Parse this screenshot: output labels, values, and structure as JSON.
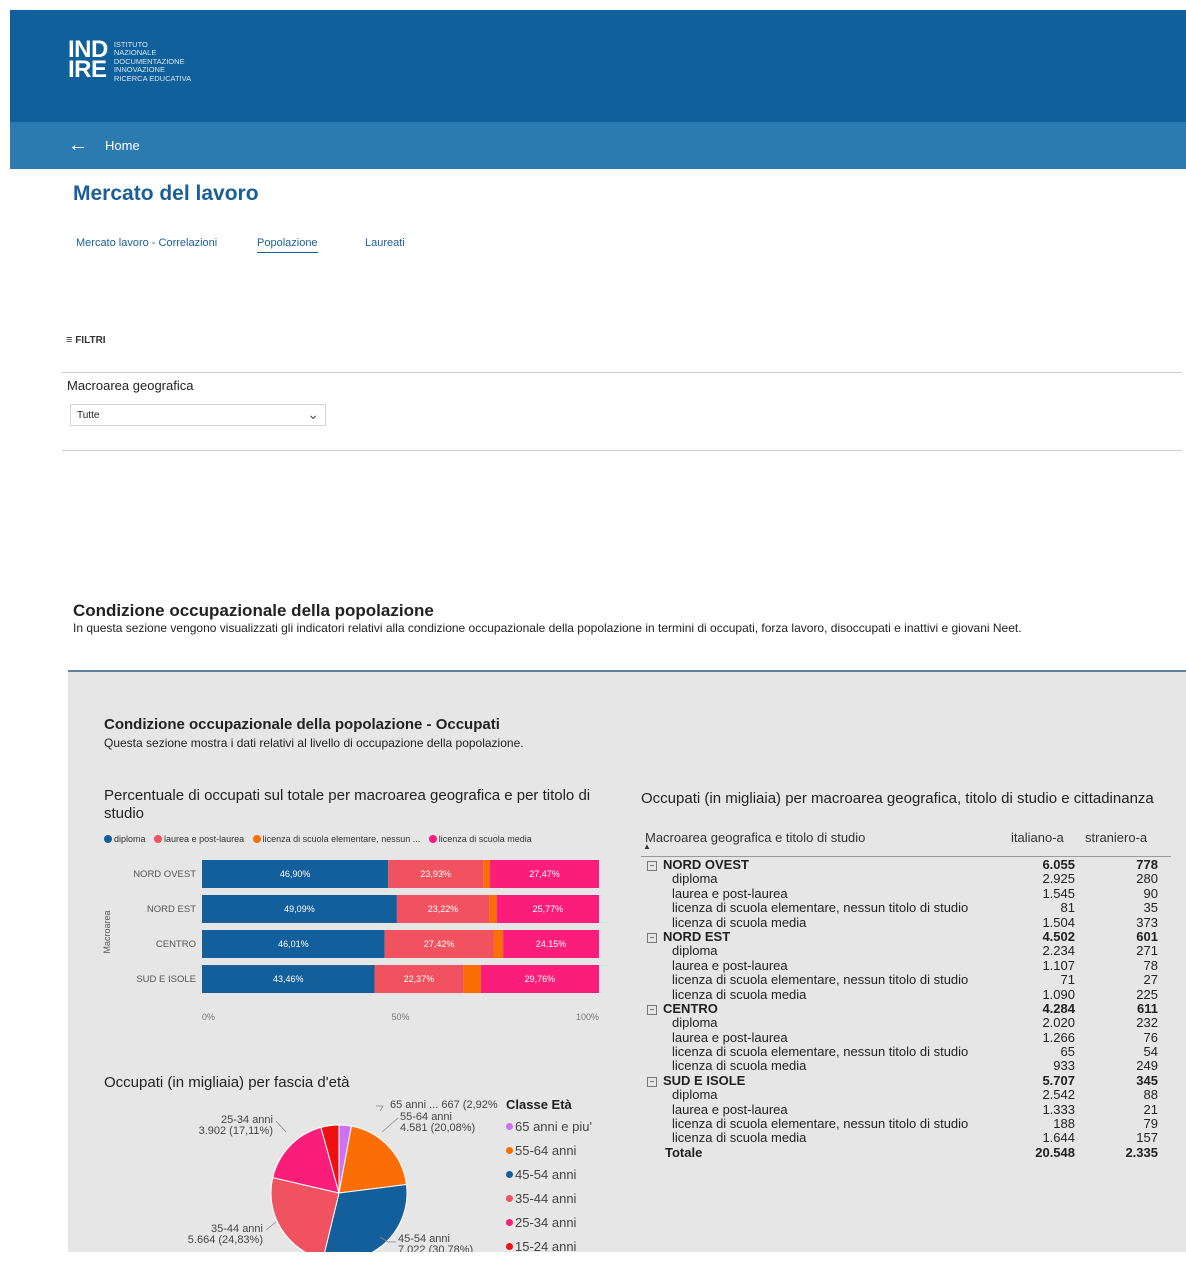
{
  "header": {
    "logo_mark_line1": "IND",
    "logo_mark_line2": "IRE",
    "logo_sub": [
      "ISTITUTO",
      "NAZIONALE",
      "DOCUMENTAZIONE",
      "INNOVAZIONE",
      "RICERCA EDUCATIVA"
    ],
    "back_icon": "arrow-left-icon",
    "home_label": "Home"
  },
  "page_title": "Mercato del lavoro",
  "tabs": [
    {
      "label": "Mercato lavoro - Correlazioni",
      "active": false
    },
    {
      "label": "Popolazione",
      "active": true
    },
    {
      "label": "Laureati",
      "active": false
    }
  ],
  "filters": {
    "label": "FILTRI",
    "icon": "filter-icon",
    "macroarea_label": "Macroarea geografica",
    "macroarea_value": "Tutte"
  },
  "section": {
    "title": "Condizione occupazionale della popolazione",
    "description": "In questa sezione vengono visualizzati gli indicatori relativi alla condizione occupazionale della popolazione in termini di occupati, forza lavoro, disoccupati e inattivi e giovani Neet."
  },
  "panel": {
    "title": "Condizione occupazionale della popolazione - Occupati",
    "description": "Questa sezione mostra i dati relativi al livello di occupazione della popolazione."
  },
  "colors": {
    "diploma": "#135f9c",
    "laurea": "#f0525f",
    "licenza_elementare": "#fb6e05",
    "licenza_media": "#fb1d7a",
    "eta_65": "#cc73f2",
    "eta_15_24": "#ee1111"
  },
  "chart_data": [
    {
      "type": "bar",
      "orientation": "horizontal-stacked-100",
      "title": "Percentuale di occupati sul totale per macroarea geografica e per titolo di studio",
      "ylabel": "Macroarea",
      "categories": [
        "NORD OVEST",
        "NORD EST",
        "CENTRO",
        "SUD E ISOLE"
      ],
      "series": [
        {
          "name": "diploma",
          "values": [
            46.9,
            49.09,
            46.01,
            43.46
          ],
          "labels": [
            "46,90%",
            "49,09%",
            "46,01%",
            "43,46%"
          ]
        },
        {
          "name": "laurea e post-laurea",
          "values": [
            23.93,
            23.22,
            27.42,
            22.37
          ],
          "labels": [
            "23,93%",
            "23,22%",
            "27,42%",
            "22,37%"
          ]
        },
        {
          "name": "licenza di scuola elementare, nessun ...",
          "values": [
            1.7,
            1.92,
            2.42,
            4.41
          ],
          "labels": [
            "",
            "",
            "",
            ""
          ]
        },
        {
          "name": "licenza di scuola media",
          "values": [
            27.47,
            25.77,
            24.15,
            29.76
          ],
          "labels": [
            "27,47%",
            "25,77%",
            "24,15%",
            "29,76%"
          ]
        }
      ],
      "xticks": [
        "0%",
        "50%",
        "100%"
      ],
      "xlim": [
        0,
        100
      ]
    },
    {
      "type": "pie",
      "title": "Occupati (in migliaia) per fascia d'età",
      "legend_title": "Classe Età",
      "slices": [
        {
          "name": "65 anni e piu'",
          "value": 667,
          "label": "65 anni ... 667 (2,92%)"
        },
        {
          "name": "55-64 anni",
          "value": 4581,
          "label": "55-64 anni\n4.581 (20,08%)"
        },
        {
          "name": "45-54 anni",
          "value": 7022,
          "label": "45-54 anni\n7.022 (30,78%)"
        },
        {
          "name": "35-44 anni",
          "value": 5664,
          "label": "35-44 anni\n5.664 (24,83%)"
        },
        {
          "name": "25-34 anni",
          "value": 3902,
          "label": "25-34 anni\n3.902 (17,11%)"
        },
        {
          "name": "15-24 anni",
          "value": 975,
          "label": ""
        }
      ],
      "legend": [
        "65 anni e piu'",
        "55-64 anni",
        "45-54 anni",
        "35-44 anni",
        "25-34 anni",
        "15-24 anni"
      ]
    }
  ],
  "table": {
    "title": "Occupati (in migliaia) per macroarea geografica, titolo di studio e cittadinanza",
    "headers": [
      "Macroarea geografica e titolo di studio",
      "italiano-a",
      "straniero-a"
    ],
    "rows": [
      {
        "type": "grp",
        "label": "NORD OVEST",
        "v1": "6.055",
        "v2": "778"
      },
      {
        "type": "sub",
        "label": "diploma",
        "v1": "2.925",
        "v2": "280"
      },
      {
        "type": "sub",
        "label": "laurea e post-laurea",
        "v1": "1.545",
        "v2": "90"
      },
      {
        "type": "sub",
        "label": "licenza di scuola elementare, nessun titolo di studio",
        "v1": "81",
        "v2": "35"
      },
      {
        "type": "sub",
        "label": "licenza di scuola media",
        "v1": "1.504",
        "v2": "373"
      },
      {
        "type": "grp",
        "label": "NORD EST",
        "v1": "4.502",
        "v2": "601"
      },
      {
        "type": "sub",
        "label": "diploma",
        "v1": "2.234",
        "v2": "271"
      },
      {
        "type": "sub",
        "label": "laurea e post-laurea",
        "v1": "1.107",
        "v2": "78"
      },
      {
        "type": "sub",
        "label": "licenza di scuola elementare, nessun titolo di studio",
        "v1": "71",
        "v2": "27"
      },
      {
        "type": "sub",
        "label": "licenza di scuola media",
        "v1": "1.090",
        "v2": "225"
      },
      {
        "type": "grp",
        "label": "CENTRO",
        "v1": "4.284",
        "v2": "611"
      },
      {
        "type": "sub",
        "label": "diploma",
        "v1": "2.020",
        "v2": "232"
      },
      {
        "type": "sub",
        "label": "laurea e post-laurea",
        "v1": "1.266",
        "v2": "76"
      },
      {
        "type": "sub",
        "label": "licenza di scuola elementare, nessun titolo di studio",
        "v1": "65",
        "v2": "54"
      },
      {
        "type": "sub",
        "label": "licenza di scuola media",
        "v1": "933",
        "v2": "249"
      },
      {
        "type": "grp",
        "label": "SUD E ISOLE",
        "v1": "5.707",
        "v2": "345"
      },
      {
        "type": "sub",
        "label": "diploma",
        "v1": "2.542",
        "v2": "88"
      },
      {
        "type": "sub",
        "label": "laurea e post-laurea",
        "v1": "1.333",
        "v2": "21"
      },
      {
        "type": "sub",
        "label": "licenza di scuola elementare, nessun titolo di studio",
        "v1": "188",
        "v2": "79"
      },
      {
        "type": "sub",
        "label": "licenza di scuola media",
        "v1": "1.644",
        "v2": "157"
      },
      {
        "type": "tot",
        "label": "Totale",
        "v1": "20.548",
        "v2": "2.335"
      }
    ]
  }
}
